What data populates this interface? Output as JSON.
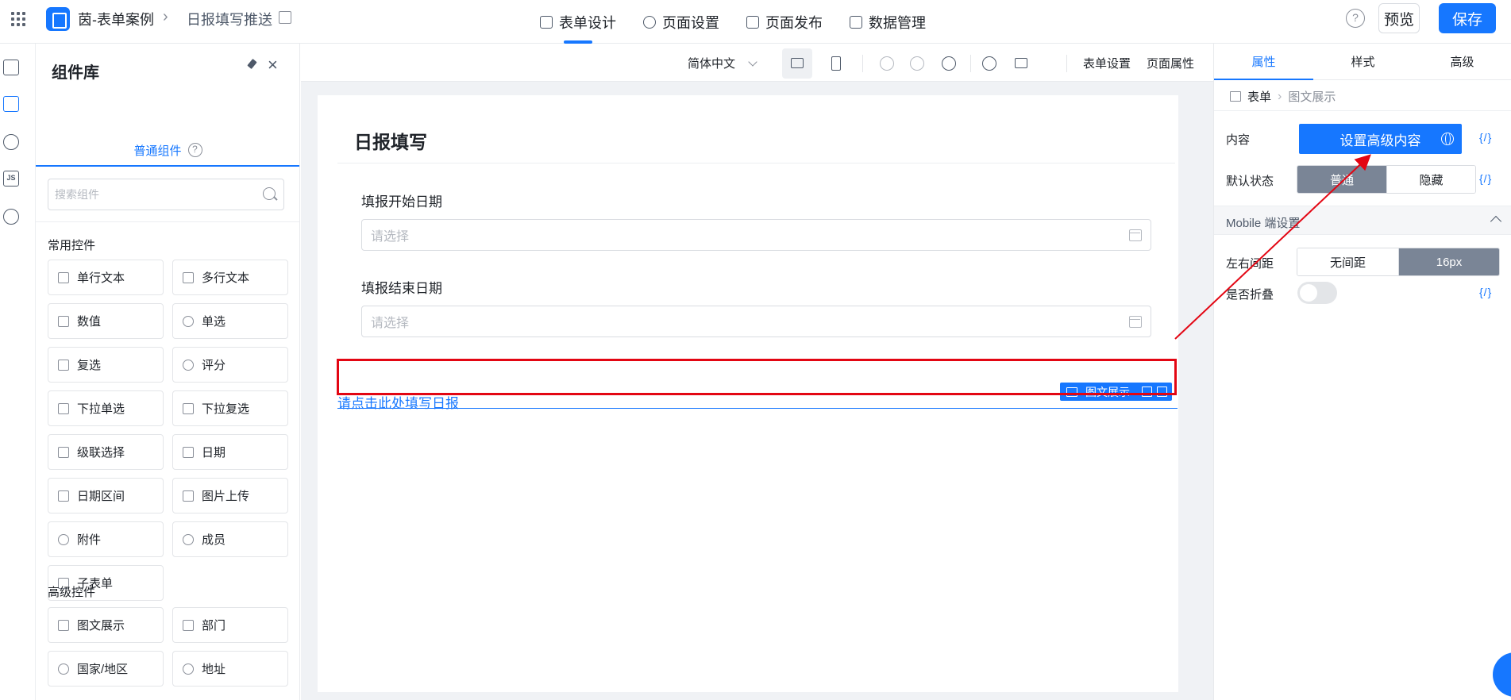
{
  "topbar": {
    "app_name": "茵-表单案例",
    "page_name": "日报填写推送",
    "tabs": [
      {
        "label": "表单设计",
        "icon": "document-icon",
        "active": true
      },
      {
        "label": "页面设置",
        "icon": "gear-icon",
        "active": false
      },
      {
        "label": "页面发布",
        "icon": "send-icon",
        "active": false
      },
      {
        "label": "数据管理",
        "icon": "table-icon",
        "active": false
      }
    ],
    "help": "?",
    "preview_label": "预览",
    "save_label": "保存"
  },
  "library": {
    "title": "组件库",
    "tab_label": "普通组件",
    "tab_help": "?",
    "search_placeholder": "搜索组件",
    "common_title": "常用控件",
    "common_items": [
      {
        "label": "单行文本",
        "icon": "single-line-text-icon"
      },
      {
        "label": "多行文本",
        "icon": "multi-line-text-icon"
      },
      {
        "label": "数值",
        "icon": "number-icon"
      },
      {
        "label": "单选",
        "icon": "radio-icon"
      },
      {
        "label": "复选",
        "icon": "checkbox-icon"
      },
      {
        "label": "评分",
        "icon": "star-icon"
      },
      {
        "label": "下拉单选",
        "icon": "dropdown-single-icon"
      },
      {
        "label": "下拉复选",
        "icon": "dropdown-multi-icon"
      },
      {
        "label": "级联选择",
        "icon": "cascade-icon"
      },
      {
        "label": "日期",
        "icon": "date-icon"
      },
      {
        "label": "日期区间",
        "icon": "date-range-icon"
      },
      {
        "label": "图片上传",
        "icon": "image-upload-icon"
      },
      {
        "label": "附件",
        "icon": "attachment-icon"
      },
      {
        "label": "成员",
        "icon": "member-icon"
      },
      {
        "label": "子表单",
        "icon": "subform-icon"
      }
    ],
    "advanced_title": "高级控件",
    "advanced_items": [
      {
        "label": "图文展示",
        "icon": "rich-text-icon"
      },
      {
        "label": "部门",
        "icon": "department-icon"
      },
      {
        "label": "国家/地区",
        "icon": "globe-icon"
      },
      {
        "label": "地址",
        "icon": "address-icon"
      }
    ]
  },
  "toolbar": {
    "language": "简体中文",
    "form_settings": "表单设置",
    "page_props": "页面属性"
  },
  "form": {
    "title": "日报填写",
    "fields": [
      {
        "label": "填报开始日期",
        "placeholder": "请选择"
      },
      {
        "label": "填报结束日期",
        "placeholder": "请选择"
      }
    ],
    "rich_text_link": "请点击此处填写日报",
    "selected_tag": "图文展示"
  },
  "props": {
    "tabs": [
      "属性",
      "样式",
      "高级"
    ],
    "crumb_root": "表单",
    "crumb_current": "图文展示",
    "content_label": "内容",
    "content_button": "设置高级内容",
    "expr": "{/}",
    "default_state_label": "默认状态",
    "state_options": [
      "普通",
      "隐藏"
    ],
    "mobile_section": "Mobile 端设置",
    "margin_label": "左右间距",
    "margin_options": [
      "无间距",
      "16px"
    ],
    "collapse_label": "是否折叠",
    "collapse_on": false
  },
  "colors": {
    "accent": "#1677ff",
    "highlight": "#e30613",
    "segment_active": "#7a8596"
  }
}
